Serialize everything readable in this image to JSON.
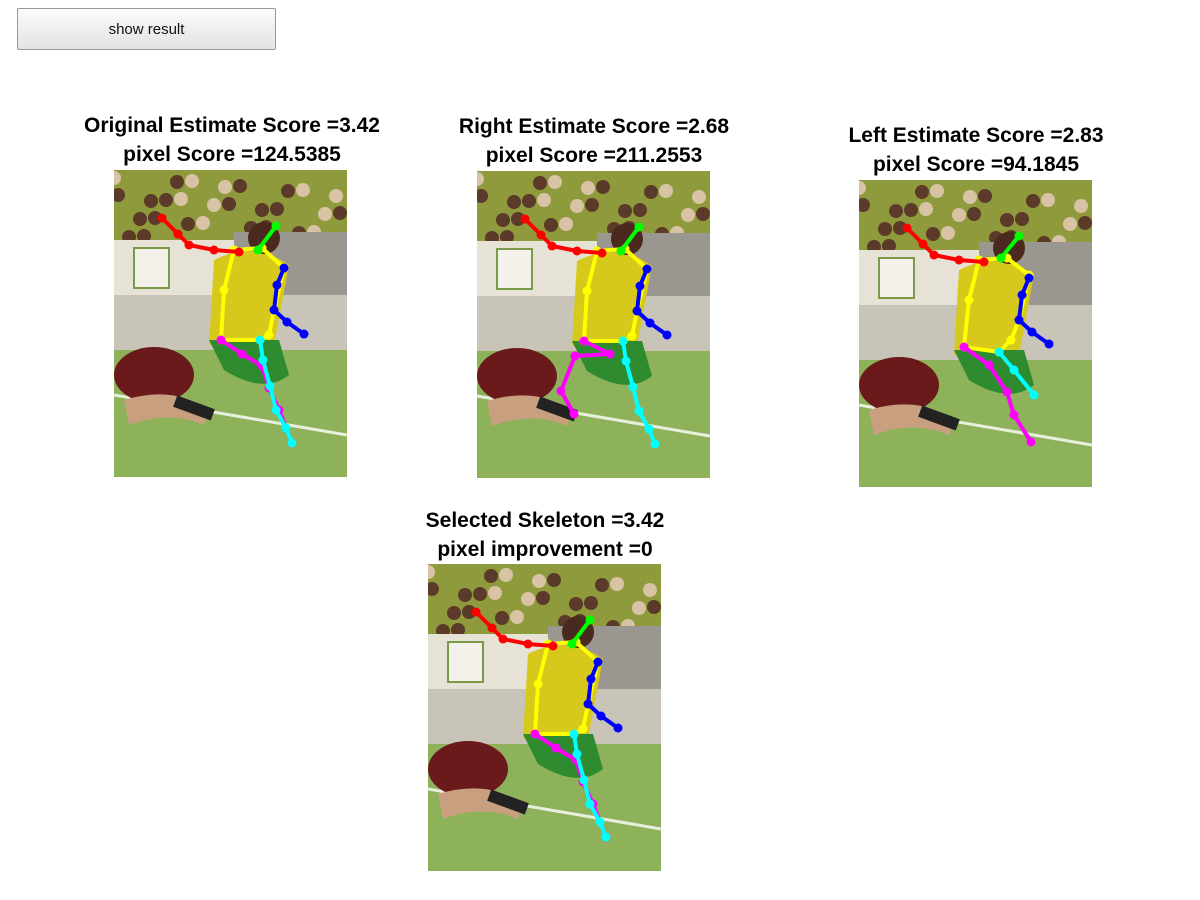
{
  "button": {
    "label": "show result"
  },
  "panels": [
    {
      "id": "original",
      "title_line1": "Original Estimate Score =3.42",
      "title_line2": "pixel Score =124.5385"
    },
    {
      "id": "right",
      "title_line1": "Right Estimate Score =2.68",
      "title_line2": "pixel Score =211.2553"
    },
    {
      "id": "left",
      "title_line1": "Left Estimate Score =2.83",
      "title_line2": "pixel Score =94.1845"
    },
    {
      "id": "selected",
      "title_line1": "Selected Skeleton =3.42",
      "title_line2": "pixel improvement =0"
    }
  ],
  "skeleton_colors": {
    "head": "#00ff00",
    "torso": "#ffff00",
    "right_arm": "#ff0000",
    "left_arm": "#0000ff",
    "right_leg": "#ff00ff",
    "left_leg": "#00ffff"
  }
}
